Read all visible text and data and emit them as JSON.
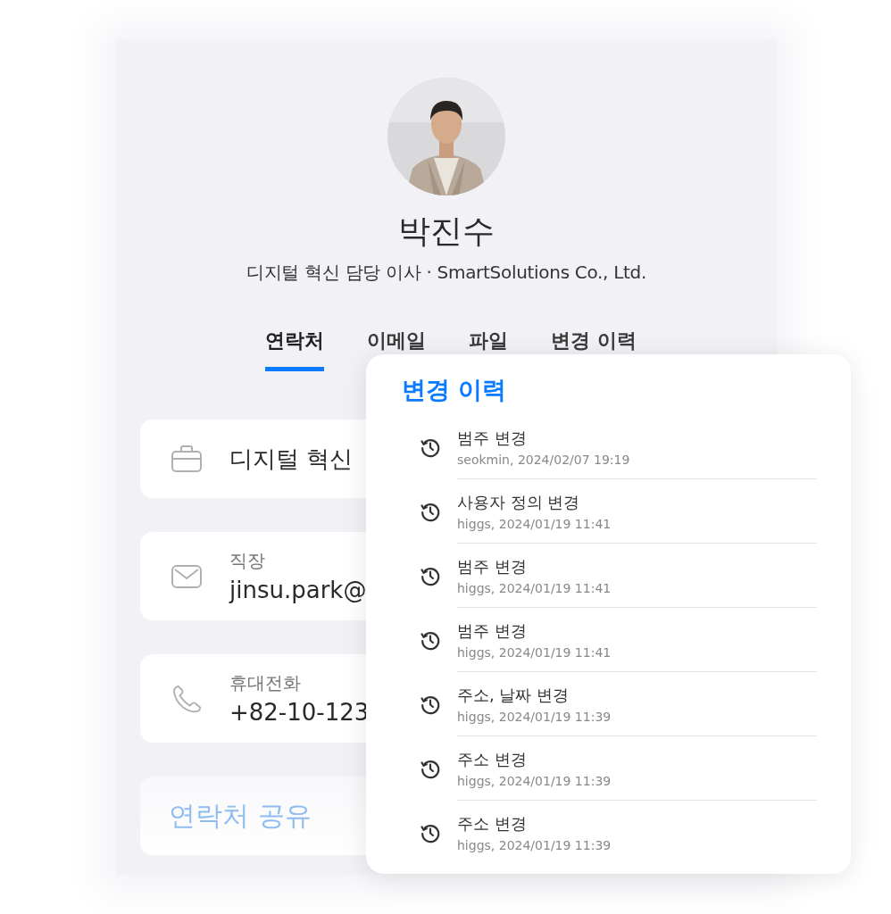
{
  "profile": {
    "name": "박진수",
    "subtitle": "디지털 혁신 담당 이사 · SmartSolutions Co., Ltd."
  },
  "tabs": [
    {
      "label": "연락처",
      "selected": true
    },
    {
      "label": "이메일",
      "selected": false
    },
    {
      "label": "파일",
      "selected": false
    },
    {
      "label": "변경 이력",
      "selected": false
    }
  ],
  "cards": [
    {
      "kind": "job",
      "value": "디지털 혁신"
    },
    {
      "kind": "email",
      "label": "직장",
      "value": "jinsu.park@"
    },
    {
      "kind": "phone",
      "label": "휴대전화",
      "value": "+82-10-123"
    },
    {
      "kind": "share",
      "value": "연락처 공유"
    }
  ],
  "history_panel": {
    "title": "변경 이력",
    "items": [
      {
        "title": "범주 변경",
        "meta": "seokmin, 2024/02/07 19:19"
      },
      {
        "title": "사용자 정의 변경",
        "meta": "higgs, 2024/01/19 11:41"
      },
      {
        "title": "범주 변경",
        "meta": "higgs, 2024/01/19 11:41"
      },
      {
        "title": "범주 변경",
        "meta": "higgs, 2024/01/19 11:41"
      },
      {
        "title": "주소, 날짜 변경",
        "meta": "higgs, 2024/01/19 11:39"
      },
      {
        "title": "주소 변경",
        "meta": "higgs, 2024/01/19 11:39"
      },
      {
        "title": "주소 변경",
        "meta": "higgs, 2024/01/19 11:39"
      }
    ]
  }
}
